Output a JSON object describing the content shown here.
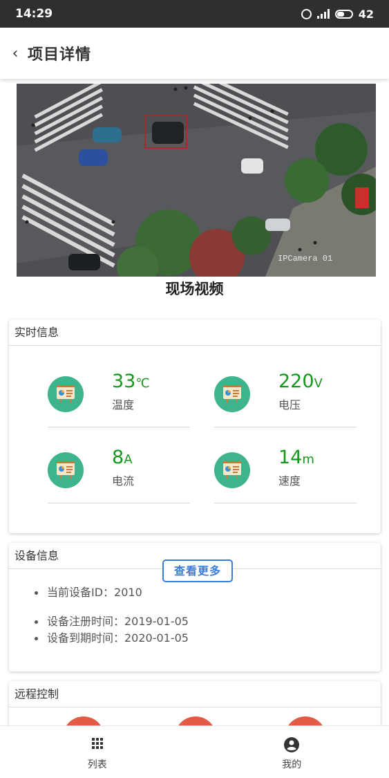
{
  "status_bar": {
    "time": "14:29",
    "battery": "42"
  },
  "header": {
    "back_label": "‹",
    "title": "项目详情"
  },
  "video": {
    "caption": "现场视频",
    "overlay_text": "IPCamera 01"
  },
  "realtime": {
    "title": "实时信息",
    "metrics": [
      {
        "value": "33",
        "unit": "℃",
        "label": "温度",
        "icon": "chart-board-icon"
      },
      {
        "value": "220",
        "unit": "V",
        "label": "电压",
        "icon": "chart-board-icon"
      },
      {
        "value": "8",
        "unit": "A",
        "label": "电流",
        "icon": "chart-board-icon"
      },
      {
        "value": "14",
        "unit": "m",
        "label": "速度",
        "icon": "chart-board-icon"
      }
    ],
    "value_color": "#15981b",
    "icon_color": "#3db38e"
  },
  "device": {
    "title": "设备信息",
    "id_text": "当前设备ID：2010",
    "register_text": "设备注册时间：2019-01-05",
    "expire_text": "设备到期时间：2020-01-05",
    "more_label": "查看更多",
    "accent": "#3a7bde"
  },
  "remote": {
    "title": "远程控制",
    "button_color": "#e25c45"
  },
  "tabbar": [
    {
      "label": "列表",
      "icon": "grid-icon"
    },
    {
      "label": "我的",
      "icon": "user-circle-icon"
    }
  ]
}
